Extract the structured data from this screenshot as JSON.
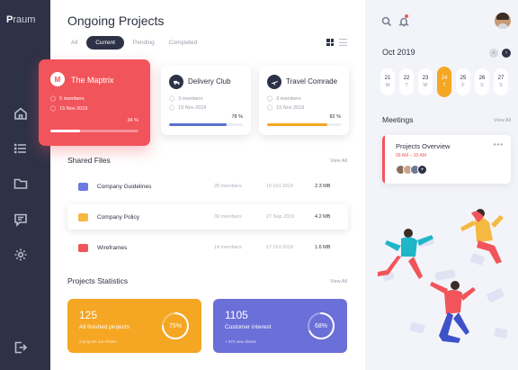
{
  "brand": {
    "first": "P",
    "rest": "raum"
  },
  "sidebar": {
    "icons": [
      "home-icon",
      "list-icon",
      "folder-icon",
      "chat-icon",
      "settings-icon",
      "logout-icon"
    ]
  },
  "header": {
    "title": "Ongoing Projects"
  },
  "tabs": [
    {
      "label": "All"
    },
    {
      "label": "Current",
      "active": true
    },
    {
      "label": "Pending"
    },
    {
      "label": "Completed"
    }
  ],
  "projects": [
    {
      "initial": "M",
      "name": "The Maptrix",
      "members": "5 members",
      "date": "15 Nov 2019",
      "pct_label": "34 %",
      "progress": 0.34,
      "color": "#f2545b"
    },
    {
      "name": "Delivery Club",
      "members": "3 members",
      "date": "15 Nov 2019",
      "pct_label": "78 %",
      "progress": 0.78,
      "color": "#5b6fd1",
      "icon": "truck-icon"
    },
    {
      "name": "Travel Comrade",
      "members": "3 members",
      "date": "15 Nov 2019",
      "pct_label": "82 %",
      "progress": 0.82,
      "color": "#f5a623",
      "icon": "plane-icon"
    }
  ],
  "shared_files": {
    "title": "Shared Files",
    "view_all": "View All",
    "rows": [
      {
        "name": "Company Guidelines",
        "members": "28 members",
        "date": "10 Oct 2019",
        "size": "2.3 MB",
        "color": "#6b79e0"
      },
      {
        "name": "Company Policy",
        "members": "30 members",
        "date": "27 Sep 2019",
        "size": "4.2 MB",
        "color": "#f5b941"
      },
      {
        "name": "Wireframes",
        "members": "14 members",
        "date": "17 Oct 2019",
        "size": "1.6 MB",
        "color": "#f2545b"
      }
    ]
  },
  "stats": {
    "title": "Projects Statistics",
    "view_all": "View All",
    "cards": [
      {
        "number": "125",
        "label": "All finished projects",
        "sub": "2 projects out of time",
        "ring_label": "75%",
        "ring": 0.75,
        "color": "#f5a623"
      },
      {
        "number": "1105",
        "label": "Customer interest",
        "sub": "+ 374 new clients",
        "ring_label": "68%",
        "ring": 0.68,
        "color": "#6b6fd8"
      }
    ]
  },
  "calendar": {
    "month": "Oct 2019",
    "prev": "‹",
    "next": "›",
    "days": [
      {
        "num": "21",
        "dl": "M"
      },
      {
        "num": "22",
        "dl": "T"
      },
      {
        "num": "23",
        "dl": "W"
      },
      {
        "num": "24",
        "dl": "T",
        "active": true
      },
      {
        "num": "25",
        "dl": "F"
      },
      {
        "num": "26",
        "dl": "S"
      },
      {
        "num": "27",
        "dl": "S"
      }
    ]
  },
  "meetings": {
    "title": "Meetings",
    "view_all": "View All",
    "card": {
      "title": "Projects Overview",
      "time": "09 AM – 10 AM",
      "more": "•••",
      "add": "+"
    }
  }
}
